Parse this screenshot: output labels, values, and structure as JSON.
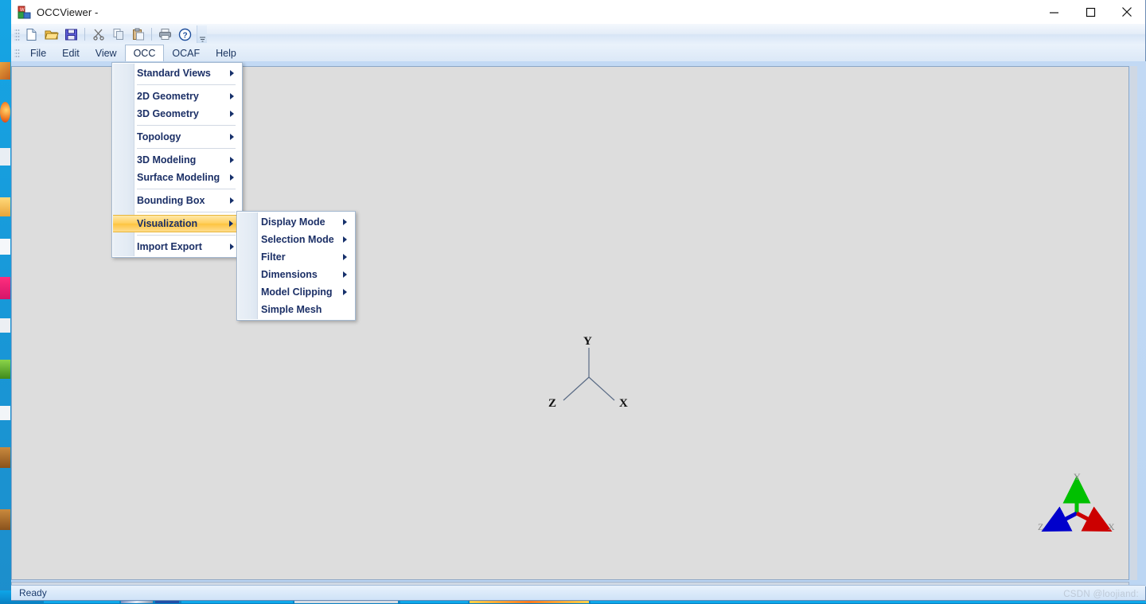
{
  "window": {
    "title": "OCCViewer -",
    "app_icon": "occviewer-app-icon",
    "controls": {
      "minimize": "minimize-icon",
      "maximize": "maximize-icon",
      "close": "close-icon"
    }
  },
  "toolbar": {
    "buttons": [
      {
        "name": "new-document",
        "icon": "new-file-icon"
      },
      {
        "name": "open-document",
        "icon": "open-folder-icon"
      },
      {
        "name": "save-document",
        "icon": "save-disk-icon"
      },
      {
        "name": "cut",
        "icon": "scissors-icon"
      },
      {
        "name": "copy",
        "icon": "copy-icon"
      },
      {
        "name": "paste",
        "icon": "clipboard-paste-icon"
      },
      {
        "name": "print",
        "icon": "printer-icon"
      },
      {
        "name": "help",
        "icon": "question-mark-icon"
      }
    ],
    "overflow_label": "toolbar-overflow-icon"
  },
  "menubar": {
    "items": [
      {
        "label": "File",
        "active": false
      },
      {
        "label": "Edit",
        "active": false
      },
      {
        "label": "View",
        "active": false
      },
      {
        "label": "OCC",
        "active": true
      },
      {
        "label": "OCAF",
        "active": false
      },
      {
        "label": "Help",
        "active": false
      }
    ]
  },
  "occ_menu": {
    "items": [
      {
        "label": "Standard Views",
        "submenu": true,
        "separator_after": true
      },
      {
        "label": "2D Geometry",
        "submenu": true,
        "separator_after": false
      },
      {
        "label": "3D Geometry",
        "submenu": true,
        "separator_after": true
      },
      {
        "label": "Topology",
        "submenu": true,
        "separator_after": true
      },
      {
        "label": "3D Modeling",
        "submenu": true,
        "separator_after": false
      },
      {
        "label": "Surface Modeling",
        "submenu": true,
        "separator_after": true
      },
      {
        "label": "Bounding Box",
        "submenu": true,
        "separator_after": true
      },
      {
        "label": "Visualization",
        "submenu": true,
        "highlighted": true,
        "separator_after": true
      },
      {
        "label": "Import Export",
        "submenu": true,
        "separator_after": false
      }
    ]
  },
  "visualization_submenu": {
    "items": [
      {
        "label": "Display Mode",
        "submenu": true
      },
      {
        "label": "Selection Mode",
        "submenu": true
      },
      {
        "label": "Filter",
        "submenu": true
      },
      {
        "label": "Dimensions",
        "submenu": true
      },
      {
        "label": "Model Clipping",
        "submenu": true
      },
      {
        "label": "Simple Mesh",
        "submenu": false
      }
    ]
  },
  "viewport": {
    "background_color": "#dddddd",
    "trihedron": {
      "axes": [
        {
          "label": "Y",
          "direction": "up"
        },
        {
          "label": "Z",
          "direction": "lower-left"
        },
        {
          "label": "X",
          "direction": "lower-right"
        }
      ]
    },
    "gizmo": {
      "axes": [
        {
          "label": "Y",
          "color": "#00c000",
          "direction": "up"
        },
        {
          "label": "Z",
          "color": "#0000cc",
          "direction": "lower-left"
        },
        {
          "label": "X",
          "color": "#cc0000",
          "direction": "lower-right"
        }
      ]
    }
  },
  "statusbar": {
    "text": "Ready"
  },
  "watermark": {
    "text": "CSDN @loojiand:"
  },
  "colors": {
    "highlight": "#fdc440",
    "menu_text": "#1b2f66",
    "title_bar": "#ffffff",
    "client": "#c2d9f4",
    "viewport": "#dddddd",
    "taskbar": "#0b8fd2"
  }
}
